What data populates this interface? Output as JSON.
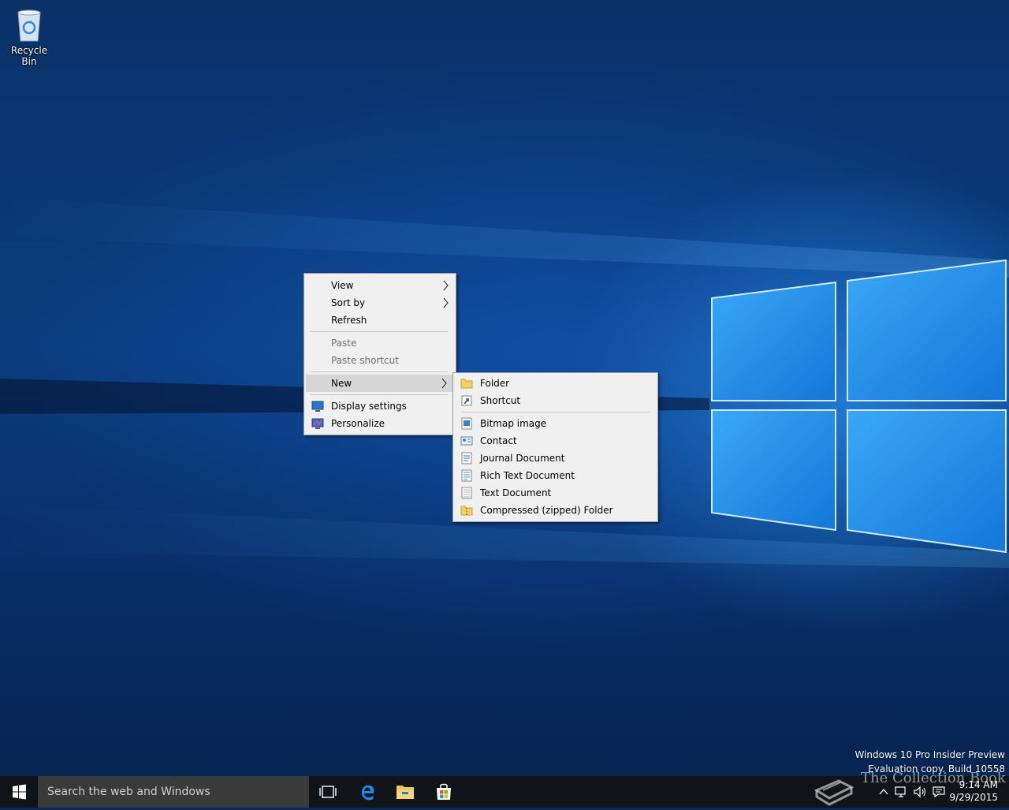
{
  "desktop": {
    "icons": [
      {
        "label": "Recycle Bin",
        "icon": "recycle-bin-icon"
      }
    ]
  },
  "context_menu": {
    "items": {
      "view": "View",
      "sort_by": "Sort by",
      "refresh": "Refresh",
      "paste": "Paste",
      "paste_shortcut": "Paste shortcut",
      "new": "New",
      "display_settings": "Display settings",
      "personalize": "Personalize"
    },
    "highlighted": "New",
    "disabled": [
      "Paste",
      "Paste shortcut"
    ]
  },
  "new_submenu": {
    "items": {
      "folder": "Folder",
      "shortcut": "Shortcut",
      "bitmap_image": "Bitmap image",
      "contact": "Contact",
      "journal_document": "Journal Document",
      "rich_text_document": "Rich Text Document",
      "text_document": "Text Document",
      "compressed_folder": "Compressed (zipped) Folder"
    }
  },
  "watermark": {
    "line1": "Windows 10 Pro Insider Preview",
    "line2": "Evaluation copy. Build 10558"
  },
  "taskbar": {
    "search_placeholder": "Search the web and Windows",
    "pinned": [
      "task-view-icon",
      "edge-icon",
      "file-explorer-icon",
      "store-icon"
    ],
    "brand_text": "The Collection Book",
    "clock": {
      "time": "9:14 AM",
      "date": "9/29/2015"
    }
  },
  "colors": {
    "taskbar": "#101418",
    "search_box": "#3a3a3a",
    "menu_background": "#f0f0f0",
    "menu_highlight": "#d6d6d6",
    "accent": "#1e8ae6"
  }
}
